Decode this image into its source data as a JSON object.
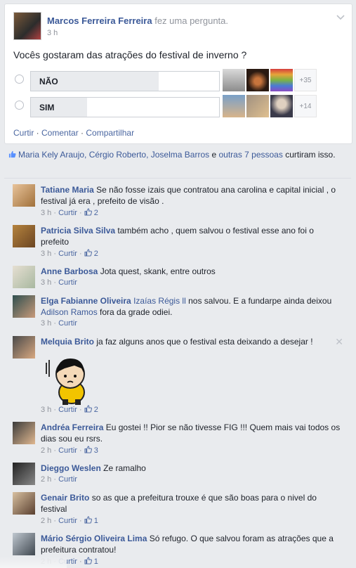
{
  "post": {
    "author": "Marcos Ferreira Ferreira",
    "action": "fez uma pergunta.",
    "time": "3 h",
    "question": "Vocês gostaram das atrações do festival de inverno ?",
    "options": [
      {
        "label": "NÃO",
        "share": 0.68,
        "more": "+35"
      },
      {
        "label": "SIM",
        "share": 0.3,
        "more": "+14"
      }
    ],
    "actions": {
      "like": "Curtir",
      "comment": "Comentar",
      "share": "Compartilhar"
    }
  },
  "likes": {
    "names": "Maria Kely Araujo, Cérgio Roberto, Joselma Barros",
    "and": " e ",
    "others": "outras 7 pessoas",
    "suffix": " curtiram isso."
  },
  "comments": [
    {
      "name": "Tatiane Maria",
      "text": "Se não fosse izais que contratou ana carolina e capital inicial , o festival já era , prefeito de visão .",
      "time": "3 h",
      "like": "Curtir",
      "count": "2"
    },
    {
      "name": "Patricia Silva Silva",
      "text": "também acho , quem salvou o festival esse ano foi o prefeito",
      "time": "3 h",
      "like": "Curtir",
      "count": "2"
    },
    {
      "name": "Anne Barbosa",
      "text": "Jota quest, skank, entre outros",
      "time": "3 h",
      "like": "Curtir",
      "count": ""
    },
    {
      "name": "Elga Fabianne Oliveira",
      "mention1": "Izaías Régis ll",
      "text": " nos salvou. E a fundarpe ainda deixou ",
      "mention2": "Adilson Ramos",
      "text2": " fora da grade odiei.",
      "time": "3 h",
      "like": "Curtir",
      "count": ""
    },
    {
      "name": "Melquia Brito",
      "text": "ja faz alguns anos que o festival esta deixando a desejar !",
      "time": "3 h",
      "like": "Curtir",
      "count": "2"
    },
    {
      "name": "Andréa Ferreira",
      "text": "Eu gostei !! Pior se não tivesse FIG !!! Quem mais vai todos os dias sou eu rsrs.",
      "time": "2 h",
      "like": "Curtir",
      "count": "3"
    },
    {
      "name": "Dieggo Weslen",
      "text": "Ze ramalho",
      "time": "2 h",
      "like": "Curtir",
      "count": ""
    },
    {
      "name": "Genair Brito",
      "text": "so as que a prefeitura trouxe é que são boas para o nivel do festival",
      "time": "2 h",
      "like": "Curtir",
      "count": "1"
    },
    {
      "name": "Mário Sérgio Oliveira Lima",
      "text": "Só refugo. O que salvou foram as atrações que a prefeitura contratou!",
      "time": "2 h",
      "like": "Curtir",
      "count": "1"
    }
  ],
  "colors": {
    "link": "#3b5998",
    "meta": "#90949c",
    "bg": "#e9ebee"
  }
}
